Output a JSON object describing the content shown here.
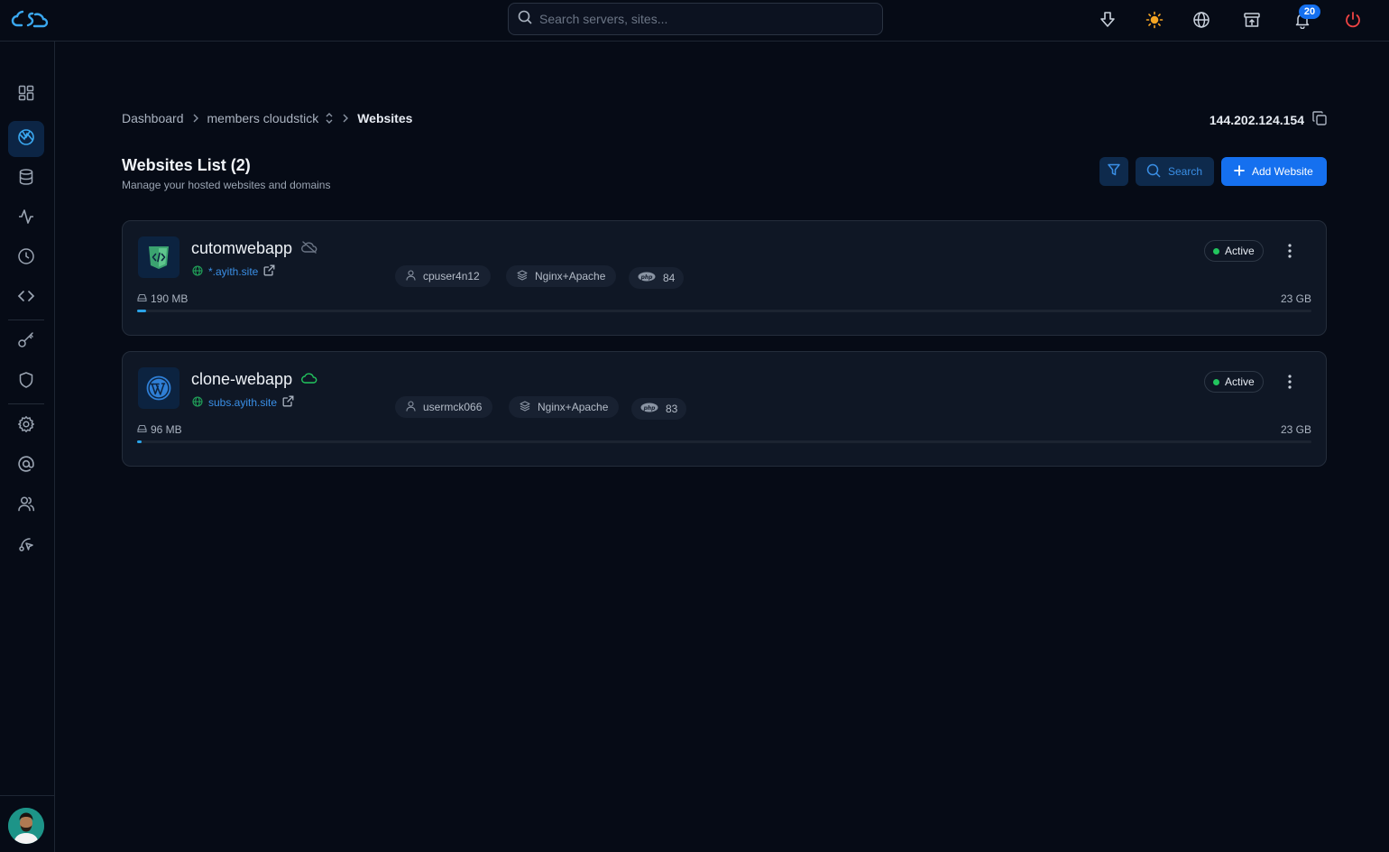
{
  "topbar": {
    "search_placeholder": "Search servers, sites...",
    "notification_count": "20",
    "icons": [
      "download-icon",
      "sun-icon",
      "globe-icon",
      "archive-icon",
      "bell-icon",
      "power-icon"
    ]
  },
  "sidebar": {
    "items": [
      "dashboard-icon",
      "websites-icon",
      "database-icon",
      "activity-icon",
      "clock-icon",
      "code-icon",
      "key-icon",
      "shield-icon",
      "settings-icon",
      "email-icon",
      "users-icon",
      "route-icon"
    ],
    "active": "websites-icon"
  },
  "breadcrumb": {
    "items": [
      "Dashboard",
      "members cloudstick",
      "Websites"
    ]
  },
  "server_ip": "144.202.124.154",
  "page": {
    "title": "Websites List (2)",
    "subtitle": "Manage your hosted websites and domains",
    "search_label": "Search",
    "add_label": "Add Website"
  },
  "websites": [
    {
      "name": "cutomwebapp",
      "domain": "*.ayith.site",
      "user": "cpuser4n12",
      "stack": "Nginx+Apache",
      "php": "84",
      "status": "Active",
      "used": "190 MB",
      "total": "23 GB",
      "usage_fraction": 0.008,
      "app_type": "custom"
    },
    {
      "name": "clone-webapp",
      "domain": "subs.ayith.site",
      "user": "usermck066",
      "stack": "Nginx+Apache",
      "php": "83",
      "status": "Active",
      "used": "96 MB",
      "total": "23 GB",
      "usage_fraction": 0.004,
      "app_type": "wordpress"
    }
  ],
  "colors": {
    "accent": "#1570ef",
    "link": "#3a8fe6",
    "active_status": "#22c55e",
    "background": "#060b16",
    "card": "#0f1725"
  }
}
